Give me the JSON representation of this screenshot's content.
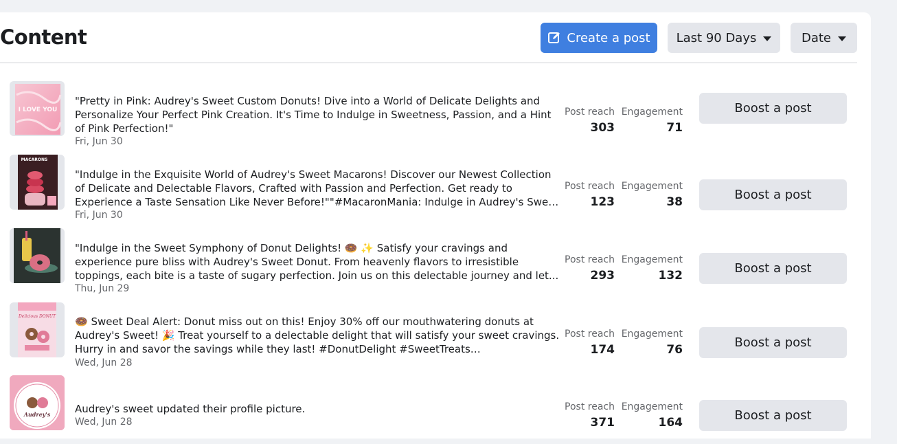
{
  "header": {
    "title": "Content",
    "create_post_label": "Create a post",
    "range_label": "Last 90 Days",
    "sort_label": "Date"
  },
  "columns": {
    "reach_label": "Post reach",
    "engagement_label": "Engagement",
    "boost_label": "Boost a post"
  },
  "posts": [
    {
      "text": "\"Pretty in Pink: Audrey's Sweet Custom Donuts! Dive into a World of Delicate Delights and Personalize Your Perfect Pink Creation. It's Time to Indulge in Sweetness, Passion, and a Hint of Pink Perfection!\"",
      "date": "Fri, Jun 30",
      "reach": "303",
      "engagement": "71",
      "thumb_label": "I LOVE YOU"
    },
    {
      "text": "\"Indulge in the Exquisite World of Audrey's Sweet Macarons! Discover our Newest Collection of Delicate and Delectable Flavors, Crafted with Passion and Perfection. Get ready to Experience a Taste Sensation Like Never Before!\"\"#MacaronMania: Indulge in Audrey's Sweet Macarons!...",
      "date": "Fri, Jun 30",
      "reach": "123",
      "engagement": "38",
      "thumb_label": "MACARONS"
    },
    {
      "text": "\"Indulge in the Sweet Symphony of Donut Delights! 🍩 ✨ Satisfy your cravings and experience pure bliss with Audrey's Sweet Donut. From heavenly flavors to irresistible toppings, each bite is a taste of sugary perfection. Join us on this delectable journey and let...",
      "date": "Thu, Jun 29",
      "reach": "293",
      "engagement": "132",
      "thumb_label": ""
    },
    {
      "text": "🍩 Sweet Deal Alert: Donut miss out on this! Enjoy 30% off our mouthwatering donuts at Audrey's Sweet! 🎉 Treat yourself to a delectable delight that will satisfy your sweet cravings. Hurry in and savor the savings while they last! #DonutDelight #SweetTreats #AudreysSweet...",
      "date": "Wed, Jun 28",
      "reach": "174",
      "engagement": "76",
      "thumb_label": "Delicious DONUT"
    },
    {
      "text": "Audrey's sweet updated their profile picture.",
      "date": "Wed, Jun 28",
      "reach": "371",
      "engagement": "164",
      "thumb_label": "Audrey's"
    }
  ]
}
